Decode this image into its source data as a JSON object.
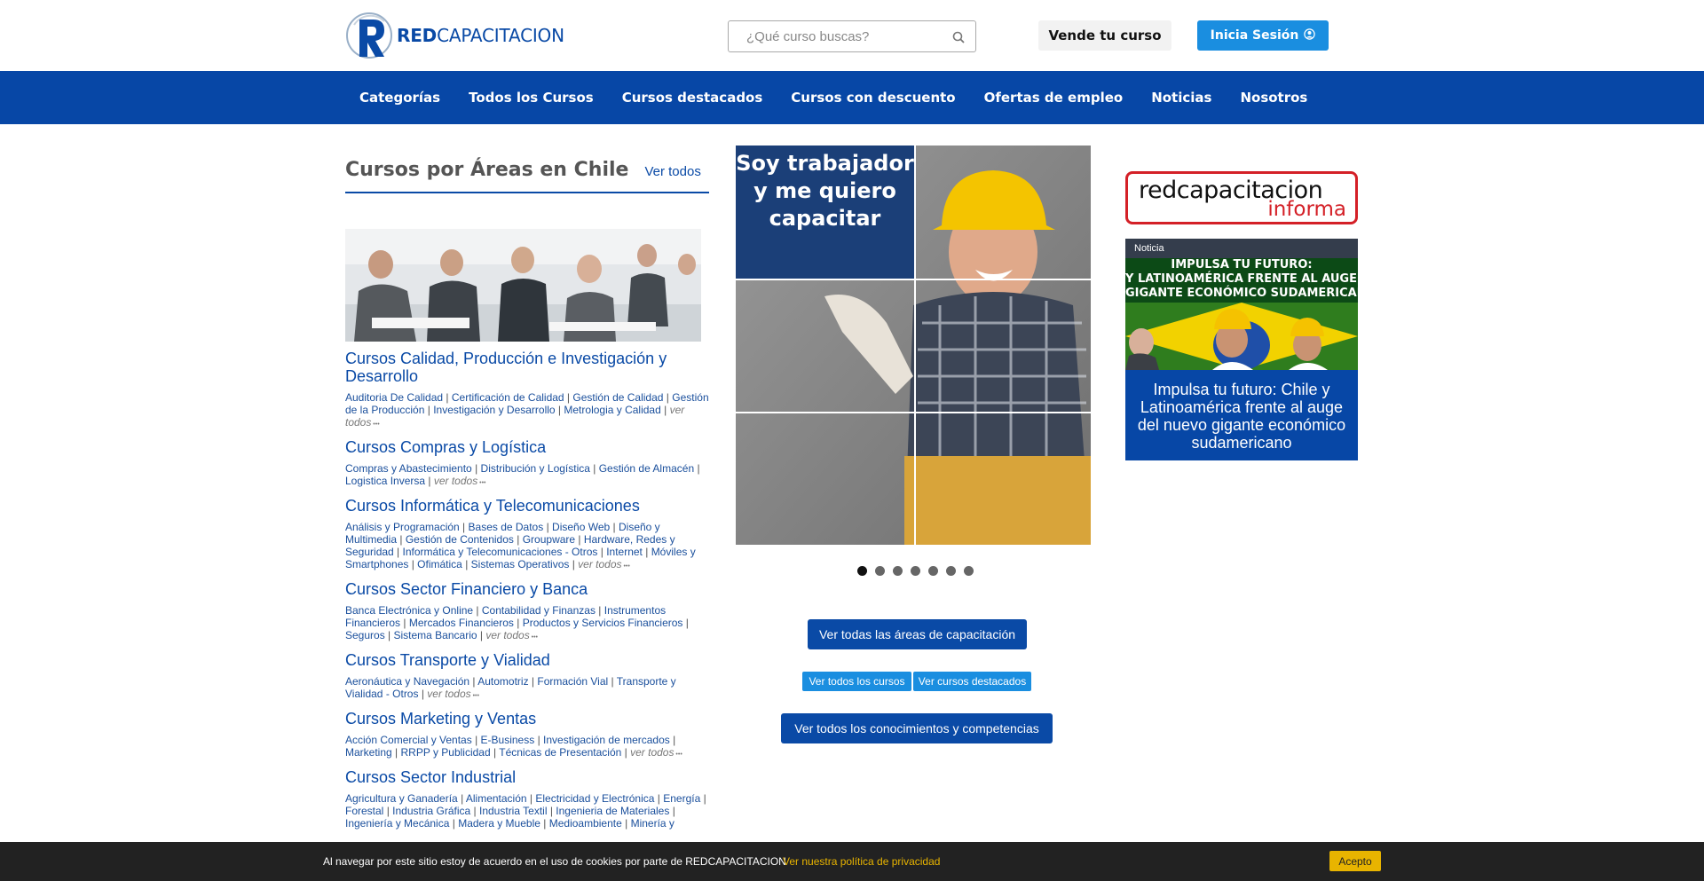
{
  "header": {
    "logo_bold": "RED",
    "logo_rest": "CAPACITACION",
    "search_placeholder": "¿Qué curso buscas?",
    "sell_button": "Vende tu curso",
    "login_button": "Inicia Sesión"
  },
  "nav": {
    "items": [
      "Categorías",
      "Todos los Cursos",
      "Cursos destacados",
      "Cursos con descuento",
      "Ofertas de empleo",
      "Noticias",
      "Nosotros"
    ]
  },
  "areas": {
    "title": "Cursos por Áreas en Chile",
    "view_all": "Ver todos",
    "see_all_label": "ver todos",
    "categories": [
      {
        "title": "Cursos Calidad, Producción e Investigación y Desarrollo",
        "links": [
          "Auditoria De Calidad",
          "Certificación de Calidad",
          "Gestión de Calidad",
          "Gestión de la Producción",
          "Investigación y Desarrollo",
          "Metrologia y Calidad"
        ]
      },
      {
        "title": "Cursos Compras y Logística",
        "links": [
          "Compras y Abastecimiento",
          "Distribución y Logística",
          "Gestión de Almacén",
          "Logistica Inversa"
        ]
      },
      {
        "title": "Cursos Informática y Telecomunicaciones",
        "links": [
          "Análisis y Programación",
          "Bases de Datos",
          "Diseño Web",
          "Diseño y Multimedia",
          "Gestión de Contenidos",
          "Groupware",
          "Hardware, Redes y Seguridad",
          "Informática y Telecomunicaciones - Otros",
          "Internet",
          "Móviles y Smartphones",
          "Ofimática",
          "Sistemas Operativos"
        ]
      },
      {
        "title": "Cursos Sector Financiero y Banca",
        "links": [
          "Banca Electrónica y Online",
          "Contabilidad y Finanzas",
          "Instrumentos Financieros",
          "Mercados Financieros",
          "Productos y Servicios Financieros",
          "Seguros",
          "Sistema Bancario"
        ]
      },
      {
        "title": "Cursos Transporte y Vialidad",
        "links": [
          "Aeronáutica y Navegación",
          "Automotriz",
          "Formación Vial",
          "Transporte y Vialidad - Otros"
        ]
      },
      {
        "title": "Cursos Marketing y Ventas",
        "links": [
          "Acción Comercial y Ventas",
          "E-Business",
          "Investigación de mercados",
          "Marketing",
          "RRPP y Publicidad",
          "Técnicas de Presentación"
        ]
      },
      {
        "title": "Cursos Sector Industrial",
        "links": [
          "Agricultura y Ganadería",
          "Alimentación",
          "Electricidad y Electrónica",
          "Energía",
          "Forestal",
          "Industria Gráfica",
          "Industria Textil",
          "Ingenieria de Materiales",
          "Ingeniería y Mecánica",
          "Madera y Mueble",
          "Medioambiente",
          "Minería y"
        ]
      }
    ]
  },
  "carousel": {
    "caption": "Soy trabajador y me quiero capacitar",
    "slide_count": 7,
    "active_index": 0
  },
  "actions": {
    "all_areas": "Ver todas las áreas de capacitación",
    "all_courses": "Ver todos los cursos",
    "featured": "Ver cursos destacados",
    "skills": "Ver todos los conocimientos y competencias"
  },
  "informa": {
    "line1": "redcapacitacion",
    "line2": "informa"
  },
  "news": {
    "tag": "Noticia",
    "image_line1": "IMPULSA TU FUTURO:",
    "image_line2": "Y LATINOAMÉRICA FRENTE AL AUGE DEL NU",
    "image_line3": "GIGANTE ECONÓMICO SUDAMERICANO",
    "title": "Impulsa tu futuro: Chile y Latinoamérica frente al auge del nuevo gigante económico sudamericano"
  },
  "cookie": {
    "text": "Al navegar por este sitio estoy de acuerdo en el uso de cookies por parte de REDCAPACITACION",
    "link": "Ver nuestra política de privacidad",
    "accept": "Acepto"
  },
  "colors": {
    "brand_blue": "#0747a6",
    "accent_blue": "#1a8ee0",
    "cookie_yellow": "#e8b400",
    "informa_red": "#d42027"
  }
}
